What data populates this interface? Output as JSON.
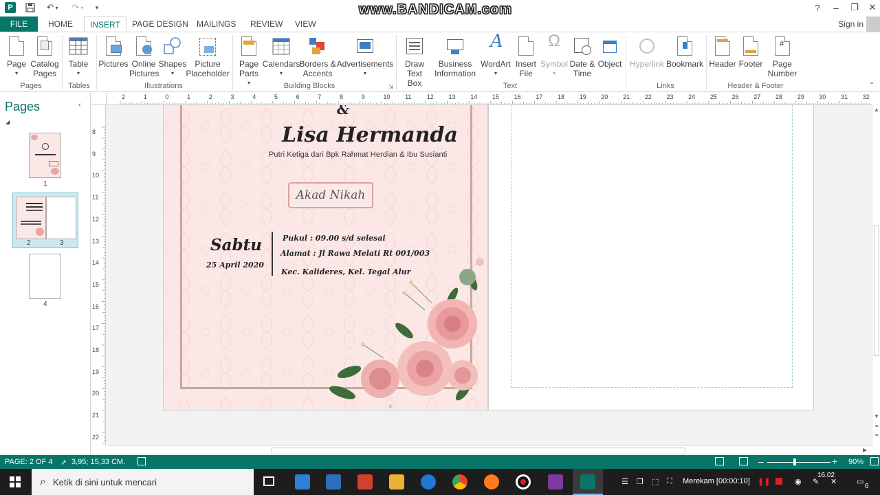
{
  "window": {
    "watermark": "www.BANDICAM.com",
    "app_logo": "P",
    "sign_in": "Sign in"
  },
  "tabs": [
    "FILE",
    "HOME",
    "INSERT",
    "PAGE DESIGN",
    "MAILINGS",
    "REVIEW",
    "VIEW"
  ],
  "ribbon": {
    "pages": {
      "label": "Pages",
      "buttons": [
        "Page",
        "Catalog Pages"
      ]
    },
    "tables": {
      "label": "Tables",
      "buttons": [
        "Table"
      ]
    },
    "illustrations": {
      "label": "Illustrations",
      "buttons": [
        "Pictures",
        "Online Pictures",
        "Shapes",
        "Picture Placeholder"
      ]
    },
    "building_blocks": {
      "label": "Building Blocks",
      "buttons": [
        "Page Parts",
        "Calendars",
        "Borders & Accents",
        "Advertisements"
      ]
    },
    "text": {
      "label": "Text",
      "buttons": [
        "Draw Text Box",
        "Business Information",
        "WordArt",
        "Insert File",
        "Symbol",
        "Date & Time",
        "Object"
      ]
    },
    "links": {
      "label": "Links",
      "buttons": [
        "Hyperlink",
        "Bookmark"
      ]
    },
    "header_footer": {
      "label": "Header & Footer",
      "buttons": [
        "Header",
        "Footer",
        "Page Number"
      ]
    }
  },
  "pages_panel": {
    "title": "Pages",
    "thumbnails": [
      "1",
      "2",
      "3",
      "4"
    ]
  },
  "ruler": {
    "h_labels": [
      "2",
      "1",
      "0",
      "1",
      "2",
      "3",
      "4",
      "5",
      "6",
      "7",
      "8",
      "9",
      "10",
      "11",
      "12",
      "13",
      "14",
      "15",
      "16",
      "17",
      "18",
      "19",
      "20",
      "21",
      "22",
      "23",
      "24",
      "25",
      "26",
      "27",
      "28",
      "29",
      "30",
      "31",
      "32"
    ],
    "v_labels": [
      "8",
      "9",
      "10",
      "11",
      "12",
      "13",
      "14",
      "15",
      "16",
      "17",
      "18",
      "19",
      "20",
      "21",
      "22"
    ]
  },
  "document": {
    "ampersand": "&",
    "bride_name": "Lisa Hermanda",
    "bride_parents": "Putri Ketiga dari Bpk Rahmat Herdian & Ibu Susianti",
    "ceremony": "Akad Nikah",
    "day": "Sabtu",
    "date": "25 April 2020",
    "time": "Pukul : 09.00 s/d selesai",
    "address": "Alamat : Jl Rawa Melati Rt 001/003",
    "district": "Kec. Kalideres, Kel. Tegal Alur"
  },
  "statusbar": {
    "page": "PAGE: 2 OF 4",
    "coords": "3,95; 15,33 CM.",
    "zoom": "90%"
  },
  "taskbar": {
    "search_placeholder": "Ketik di sini untuk mencari",
    "recording": "Merekam [00:00:10]",
    "time": "16.02",
    "notifications": "6"
  },
  "colors": {
    "accent": "#077568",
    "page_bg": "#fbe8e6",
    "frame": "#c9a79c"
  }
}
